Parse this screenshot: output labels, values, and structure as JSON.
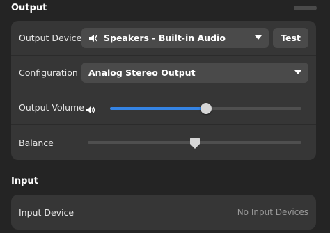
{
  "output": {
    "section_title": "Output",
    "device": {
      "label": "Output Device",
      "selected": "Speakers - Built-in Audio",
      "device_icon": "speaker-icon",
      "test_label": "Test"
    },
    "configuration": {
      "label": "Configuration",
      "selected": "Analog Stereo Output"
    },
    "volume": {
      "label": "Output Volume",
      "icon": "speaker-volume-icon",
      "level": 0.5
    },
    "balance": {
      "label": "Balance",
      "position": 0.5
    }
  },
  "input": {
    "section_title": "Input",
    "device": {
      "label": "Input Device",
      "value": "No Input Devices"
    }
  },
  "colors": {
    "background": "#242424",
    "card": "#363636",
    "control": "#4a4a4a",
    "accent": "#3584e4",
    "muted_text": "#9a9a9a"
  }
}
